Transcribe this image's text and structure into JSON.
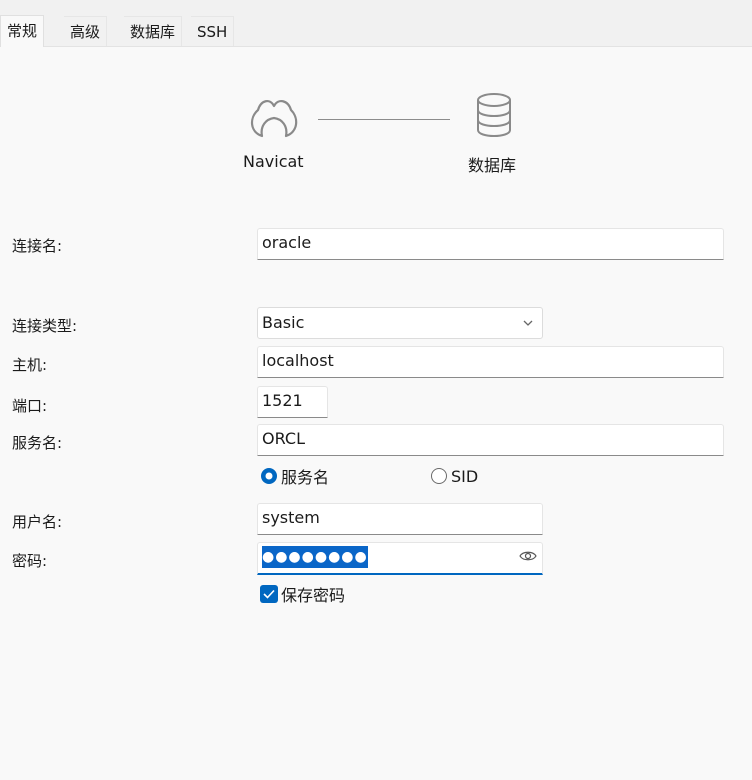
{
  "tabs": [
    {
      "label": "常规",
      "active": true
    },
    {
      "label": "高级",
      "active": false
    },
    {
      "label": "数据库",
      "active": false
    },
    {
      "label": "SSH",
      "active": false
    }
  ],
  "diagram": {
    "left_label": "Navicat",
    "right_label": "数据库",
    "left_icon": "navicat-logo-icon",
    "right_icon": "database-icon"
  },
  "form": {
    "connection_name": {
      "label": "连接名:",
      "value": "oracle"
    },
    "connection_type": {
      "label": "连接类型:",
      "value": "Basic"
    },
    "host": {
      "label": "主机:",
      "value": "localhost"
    },
    "port": {
      "label": "端口:",
      "value": "1521"
    },
    "service_name": {
      "label": "服务名:",
      "value": "ORCL"
    },
    "service_type": {
      "options": [
        "服务名",
        "SID"
      ],
      "selected": "服务名"
    },
    "username": {
      "label": "用户名:",
      "value": "system"
    },
    "password": {
      "label": "密码:",
      "value": "●●●●●●●●●"
    },
    "save_password": {
      "label": "保存密码",
      "checked": true
    }
  },
  "colors": {
    "accent": "#0067c0",
    "background": "#f9f9f9"
  }
}
